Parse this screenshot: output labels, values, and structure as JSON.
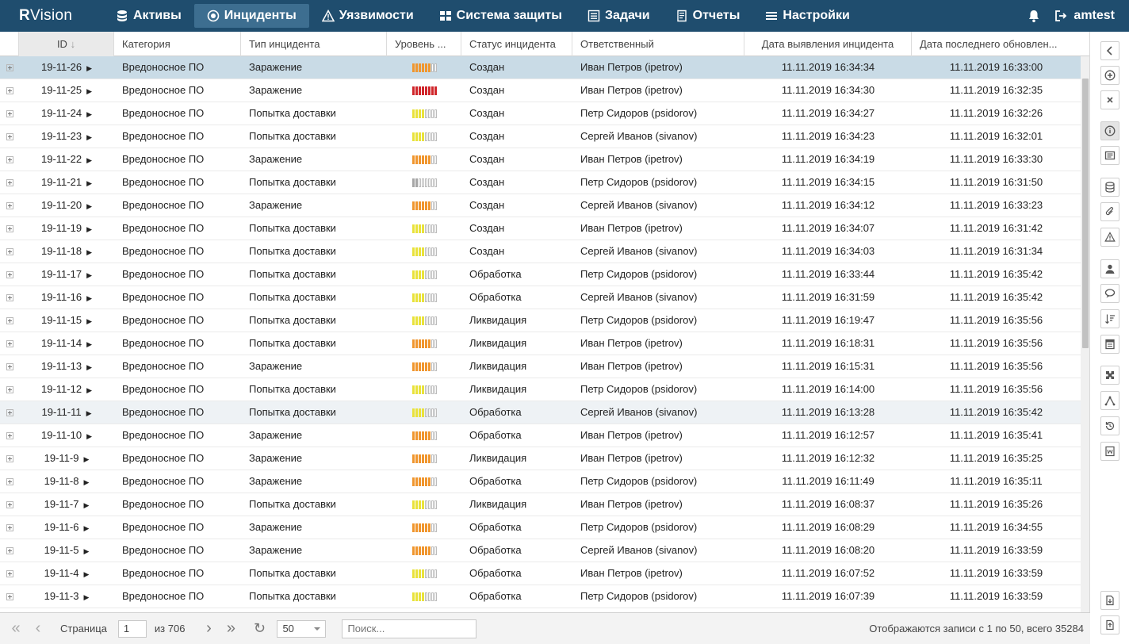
{
  "app": {
    "logo_r": "R",
    "logo_rest": "Vision"
  },
  "nav": [
    {
      "label": "Активы",
      "icon": "database-icon"
    },
    {
      "label": "Инциденты",
      "icon": "target-icon",
      "active": true
    },
    {
      "label": "Уязвимости",
      "icon": "warning-icon"
    },
    {
      "label": "Система защиты",
      "icon": "grid-icon"
    },
    {
      "label": "Задачи",
      "icon": "tasks-icon"
    },
    {
      "label": "Отчеты",
      "icon": "report-icon"
    },
    {
      "label": "Настройки",
      "icon": "menu-icon"
    }
  ],
  "user": {
    "name": "amtest"
  },
  "columns": {
    "id": "ID",
    "category": "Категория",
    "type": "Тип инцидента",
    "level": "Уровень ...",
    "status": "Статус инцидента",
    "responsible": "Ответственный",
    "detected": "Дата выявления инцидента",
    "updated": "Дата последнего обновлен..."
  },
  "level_colors": {
    "orange": "#f0962e",
    "red": "#d0262b",
    "yellow": "#e9e23a",
    "gray": "#a6a6a6"
  },
  "rows": [
    {
      "id": "19-11-26",
      "category": "Вредоносное ПО",
      "type": "Заражение",
      "level": {
        "color": "orange",
        "filled": 6,
        "total": 8
      },
      "status": "Создан",
      "responsible": "Иван Петров (ipetrov)",
      "detected": "11.11.2019 16:34:34",
      "updated": "11.11.2019 16:33:00",
      "state": "sel"
    },
    {
      "id": "19-11-25",
      "category": "Вредоносное ПО",
      "type": "Заражение",
      "level": {
        "color": "red",
        "filled": 8,
        "total": 8
      },
      "status": "Создан",
      "responsible": "Иван Петров (ipetrov)",
      "detected": "11.11.2019 16:34:30",
      "updated": "11.11.2019 16:32:35"
    },
    {
      "id": "19-11-24",
      "category": "Вредоносное ПО",
      "type": "Попытка доставки",
      "level": {
        "color": "yellow",
        "filled": 4,
        "total": 8
      },
      "status": "Создан",
      "responsible": "Петр Сидоров (psidorov)",
      "detected": "11.11.2019 16:34:27",
      "updated": "11.11.2019 16:32:26"
    },
    {
      "id": "19-11-23",
      "category": "Вредоносное ПО",
      "type": "Попытка доставки",
      "level": {
        "color": "yellow",
        "filled": 4,
        "total": 8
      },
      "status": "Создан",
      "responsible": "Сергей Иванов (sivanov)",
      "detected": "11.11.2019 16:34:23",
      "updated": "11.11.2019 16:32:01"
    },
    {
      "id": "19-11-22",
      "category": "Вредоносное ПО",
      "type": "Заражение",
      "level": {
        "color": "orange",
        "filled": 6,
        "total": 8
      },
      "status": "Создан",
      "responsible": "Иван Петров (ipetrov)",
      "detected": "11.11.2019 16:34:19",
      "updated": "11.11.2019 16:33:30"
    },
    {
      "id": "19-11-21",
      "category": "Вредоносное ПО",
      "type": "Попытка доставки",
      "level": {
        "color": "gray",
        "filled": 2,
        "total": 8
      },
      "status": "Создан",
      "responsible": "Петр Сидоров (psidorov)",
      "detected": "11.11.2019 16:34:15",
      "updated": "11.11.2019 16:31:50"
    },
    {
      "id": "19-11-20",
      "category": "Вредоносное ПО",
      "type": "Заражение",
      "level": {
        "color": "orange",
        "filled": 6,
        "total": 8
      },
      "status": "Создан",
      "responsible": "Сергей Иванов (sivanov)",
      "detected": "11.11.2019 16:34:12",
      "updated": "11.11.2019 16:33:23"
    },
    {
      "id": "19-11-19",
      "category": "Вредоносное ПО",
      "type": "Попытка доставки",
      "level": {
        "color": "yellow",
        "filled": 4,
        "total": 8
      },
      "status": "Создан",
      "responsible": "Иван Петров (ipetrov)",
      "detected": "11.11.2019 16:34:07",
      "updated": "11.11.2019 16:31:42"
    },
    {
      "id": "19-11-18",
      "category": "Вредоносное ПО",
      "type": "Попытка доставки",
      "level": {
        "color": "yellow",
        "filled": 4,
        "total": 8
      },
      "status": "Создан",
      "responsible": "Сергей Иванов (sivanov)",
      "detected": "11.11.2019 16:34:03",
      "updated": "11.11.2019 16:31:34"
    },
    {
      "id": "19-11-17",
      "category": "Вредоносное ПО",
      "type": "Попытка доставки",
      "level": {
        "color": "yellow",
        "filled": 4,
        "total": 8
      },
      "status": "Обработка",
      "responsible": "Петр Сидоров (psidorov)",
      "detected": "11.11.2019 16:33:44",
      "updated": "11.11.2019 16:35:42"
    },
    {
      "id": "19-11-16",
      "category": "Вредоносное ПО",
      "type": "Попытка доставки",
      "level": {
        "color": "yellow",
        "filled": 4,
        "total": 8
      },
      "status": "Обработка",
      "responsible": "Сергей Иванов (sivanov)",
      "detected": "11.11.2019 16:31:59",
      "updated": "11.11.2019 16:35:42"
    },
    {
      "id": "19-11-15",
      "category": "Вредоносное ПО",
      "type": "Попытка доставки",
      "level": {
        "color": "yellow",
        "filled": 4,
        "total": 8
      },
      "status": "Ликвидация",
      "responsible": "Петр Сидоров (psidorov)",
      "detected": "11.11.2019 16:19:47",
      "updated": "11.11.2019 16:35:56"
    },
    {
      "id": "19-11-14",
      "category": "Вредоносное ПО",
      "type": "Попытка доставки",
      "level": {
        "color": "orange",
        "filled": 6,
        "total": 8
      },
      "status": "Ликвидация",
      "responsible": "Иван Петров (ipetrov)",
      "detected": "11.11.2019 16:18:31",
      "updated": "11.11.2019 16:35:56"
    },
    {
      "id": "19-11-13",
      "category": "Вредоносное ПО",
      "type": "Заражение",
      "level": {
        "color": "orange",
        "filled": 6,
        "total": 8
      },
      "status": "Ликвидация",
      "responsible": "Иван Петров (ipetrov)",
      "detected": "11.11.2019 16:15:31",
      "updated": "11.11.2019 16:35:56"
    },
    {
      "id": "19-11-12",
      "category": "Вредоносное ПО",
      "type": "Попытка доставки",
      "level": {
        "color": "yellow",
        "filled": 4,
        "total": 8
      },
      "status": "Ликвидация",
      "responsible": "Петр Сидоров (psidorov)",
      "detected": "11.11.2019 16:14:00",
      "updated": "11.11.2019 16:35:56"
    },
    {
      "id": "19-11-11",
      "category": "Вредоносное ПО",
      "type": "Попытка доставки",
      "level": {
        "color": "yellow",
        "filled": 4,
        "total": 8
      },
      "status": "Обработка",
      "responsible": "Сергей Иванов (sivanov)",
      "detected": "11.11.2019 16:13:28",
      "updated": "11.11.2019 16:35:42",
      "state": "hl"
    },
    {
      "id": "19-11-10",
      "category": "Вредоносное ПО",
      "type": "Заражение",
      "level": {
        "color": "orange",
        "filled": 6,
        "total": 8
      },
      "status": "Обработка",
      "responsible": "Иван Петров (ipetrov)",
      "detected": "11.11.2019 16:12:57",
      "updated": "11.11.2019 16:35:41"
    },
    {
      "id": "19-11-9",
      "category": "Вредоносное ПО",
      "type": "Заражение",
      "level": {
        "color": "orange",
        "filled": 6,
        "total": 8
      },
      "status": "Ликвидация",
      "responsible": "Иван Петров (ipetrov)",
      "detected": "11.11.2019 16:12:32",
      "updated": "11.11.2019 16:35:25"
    },
    {
      "id": "19-11-8",
      "category": "Вредоносное ПО",
      "type": "Заражение",
      "level": {
        "color": "orange",
        "filled": 6,
        "total": 8
      },
      "status": "Обработка",
      "responsible": "Петр Сидоров (psidorov)",
      "detected": "11.11.2019 16:11:49",
      "updated": "11.11.2019 16:35:11"
    },
    {
      "id": "19-11-7",
      "category": "Вредоносное ПО",
      "type": "Попытка доставки",
      "level": {
        "color": "yellow",
        "filled": 4,
        "total": 8
      },
      "status": "Ликвидация",
      "responsible": "Иван Петров (ipetrov)",
      "detected": "11.11.2019 16:08:37",
      "updated": "11.11.2019 16:35:26"
    },
    {
      "id": "19-11-6",
      "category": "Вредоносное ПО",
      "type": "Заражение",
      "level": {
        "color": "orange",
        "filled": 6,
        "total": 8
      },
      "status": "Обработка",
      "responsible": "Петр Сидоров (psidorov)",
      "detected": "11.11.2019 16:08:29",
      "updated": "11.11.2019 16:34:55"
    },
    {
      "id": "19-11-5",
      "category": "Вредоносное ПО",
      "type": "Заражение",
      "level": {
        "color": "orange",
        "filled": 6,
        "total": 8
      },
      "status": "Обработка",
      "responsible": "Сергей Иванов (sivanov)",
      "detected": "11.11.2019 16:08:20",
      "updated": "11.11.2019 16:33:59"
    },
    {
      "id": "19-11-4",
      "category": "Вредоносное ПО",
      "type": "Попытка доставки",
      "level": {
        "color": "yellow",
        "filled": 4,
        "total": 8
      },
      "status": "Обработка",
      "responsible": "Иван Петров (ipetrov)",
      "detected": "11.11.2019 16:07:52",
      "updated": "11.11.2019 16:33:59"
    },
    {
      "id": "19-11-3",
      "category": "Вредоносное ПО",
      "type": "Попытка доставки",
      "level": {
        "color": "yellow",
        "filled": 4,
        "total": 8
      },
      "status": "Обработка",
      "responsible": "Петр Сидоров (psidorov)",
      "detected": "11.11.2019 16:07:39",
      "updated": "11.11.2019 16:33:59"
    }
  ],
  "pager": {
    "page_label": "Страница",
    "page": "1",
    "of_label": "из 706",
    "page_size": "50",
    "search_placeholder": "Поиск...",
    "info": "Отображаются записи с 1 по 50, всего 35284"
  },
  "toolbar": [
    "collapse-icon",
    "add-icon",
    "close-icon",
    "info-icon",
    "card-icon",
    "database-icon",
    "attachment-icon",
    "warning-icon",
    "person-icon",
    "comment-icon",
    "sort-icon",
    "document-icon",
    "puzzle-icon",
    "graph-icon",
    "history-icon",
    "word-icon",
    "export-icon",
    "import-icon"
  ]
}
